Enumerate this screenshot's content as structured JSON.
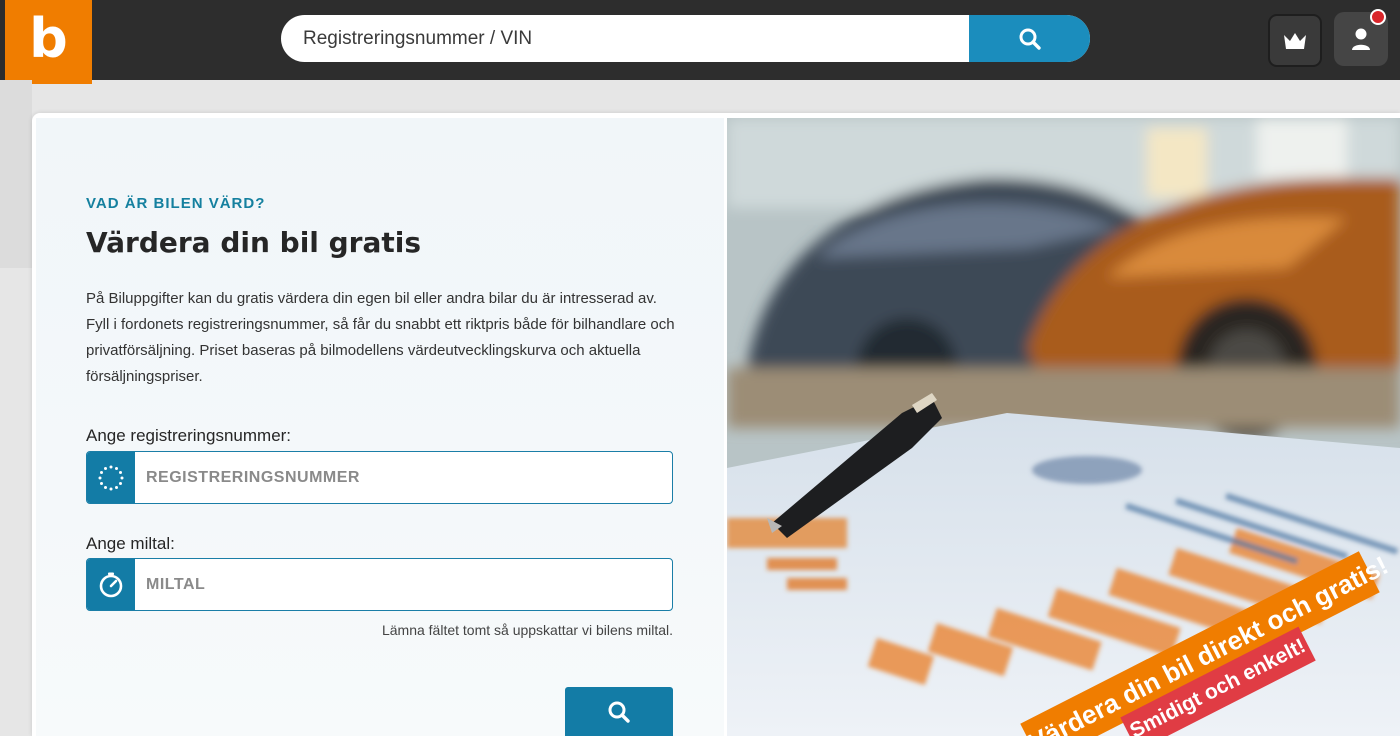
{
  "header": {
    "logo_letter": "b",
    "search_placeholder": "Registreringsnummer / VIN",
    "search_icon": "search-icon",
    "premium_icon": "crown-icon",
    "account_icon": "user-icon",
    "notification_color": "#d9262b"
  },
  "valuation": {
    "eyebrow": "VAD ÄR BILEN VÄRD?",
    "title": "Värdera din bil gratis",
    "intro": "På Biluppgifter kan du gratis värdera din egen bil eller andra bilar du är intresserad av. Fyll i fordonets registreringsnummer, så får du snabbt ett riktpris både för bilhandlare och privatförsäljning. Priset baseras på bilmodellens värdeutvecklingskurva och aktuella försäljningspriser.",
    "reg_label": "Ange registreringsnummer:",
    "reg_placeholder": "REGISTRERINGSNUMMER",
    "reg_icon": "eu-stars-icon",
    "mileage_label": "Ange miltal:",
    "mileage_placeholder": "MILTAL",
    "mileage_icon": "speedometer-icon",
    "mileage_hint": "Lämna fältet tomt så uppskattar vi bilens miltal.",
    "submit_icon": "search-icon"
  },
  "hero": {
    "ribbon_main": "Värdera din bil direkt och gratis!",
    "ribbon_secondary": "Smidigt och enkelt!"
  },
  "colors": {
    "brand_orange": "#f07d00",
    "accent_blue": "#137ca6",
    "header_dark": "#2d2d2d",
    "ribbon_red": "#e03c44"
  }
}
